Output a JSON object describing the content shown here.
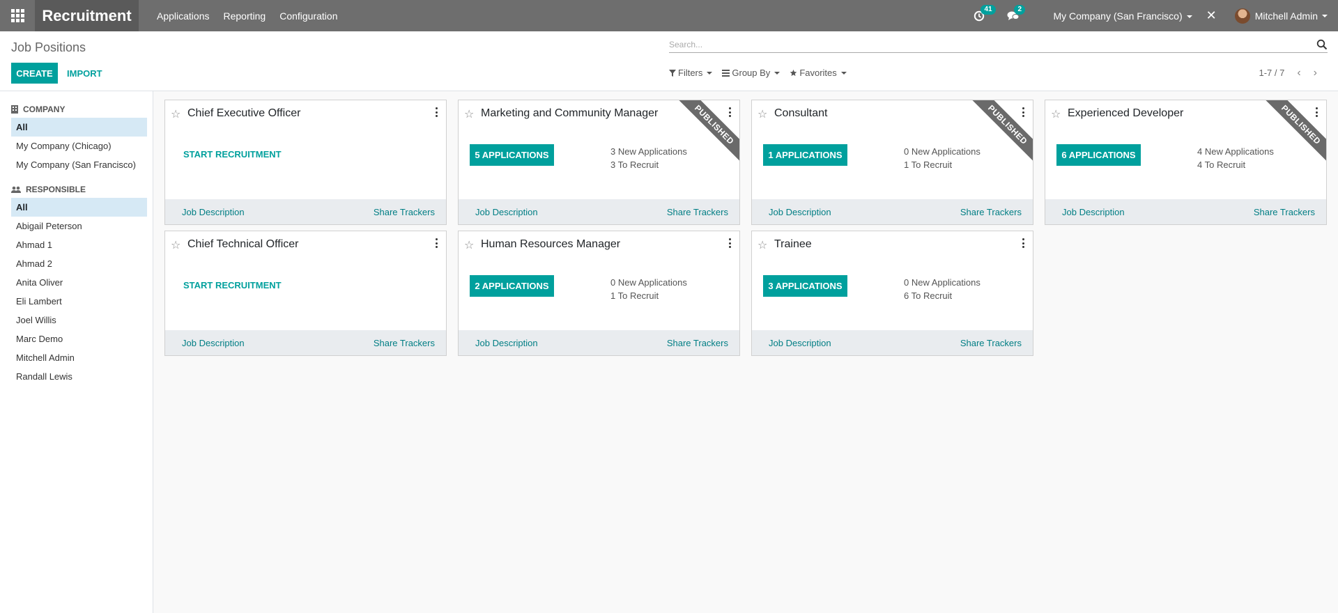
{
  "navbar": {
    "app_title": "Recruitment",
    "menu": [
      "Applications",
      "Reporting",
      "Configuration"
    ],
    "activity_count": "41",
    "message_count": "2",
    "company": "My Company (San Francisco)",
    "user": "Mitchell Admin"
  },
  "control_panel": {
    "title": "Job Positions",
    "create_label": "CREATE",
    "import_label": "IMPORT",
    "search_placeholder": "Search...",
    "filters_label": "Filters",
    "groupby_label": "Group By",
    "favorites_label": "Favorites",
    "pager": "1-7 / 7"
  },
  "sidebar": {
    "company_header": "COMPANY",
    "companies": [
      "All",
      "My Company (Chicago)",
      "My Company (San Francisco)"
    ],
    "responsible_header": "RESPONSIBLE",
    "responsibles": [
      "All",
      "Abigail Peterson",
      "Ahmad 1",
      "Ahmad 2",
      "Anita Oliver",
      "Eli Lambert",
      "Joel Willis",
      "Marc Demo",
      "Mitchell Admin",
      "Randall Lewis"
    ]
  },
  "colors": {
    "navbar": "#6e6e6e",
    "brand_bg": "#5a5a5a",
    "primary": "#00a09d",
    "ribbon": "#6a6a6a",
    "active_filter": "#d6e9f5",
    "footer_bg": "#e9ecef"
  },
  "cards": [
    {
      "title": "Chief Executive Officer",
      "published": false,
      "action": "START RECRUITMENT",
      "applications": null,
      "new_apps": null,
      "to_recruit": null,
      "job_desc": "Job Description",
      "share": "Share Trackers"
    },
    {
      "title": "Marketing and Community Manager",
      "published": true,
      "ribbon": "PUBLISHED",
      "applications": "5 APPLICATIONS",
      "new_apps": "3 New Applications",
      "to_recruit": "3 To Recruit",
      "job_desc": "Job Description",
      "share": "Share Trackers"
    },
    {
      "title": "Consultant",
      "published": true,
      "ribbon": "PUBLISHED",
      "applications": "1 APPLICATIONS",
      "new_apps": "0 New Applications",
      "to_recruit": "1 To Recruit",
      "job_desc": "Job Description",
      "share": "Share Trackers"
    },
    {
      "title": "Experienced Developer",
      "published": true,
      "ribbon": "PUBLISHED",
      "applications": "6 APPLICATIONS",
      "new_apps": "4 New Applications",
      "to_recruit": "4 To Recruit",
      "job_desc": "Job Description",
      "share": "Share Trackers"
    },
    {
      "title": "Chief Technical Officer",
      "published": false,
      "action": "START RECRUITMENT",
      "applications": null,
      "new_apps": null,
      "to_recruit": null,
      "job_desc": "Job Description",
      "share": "Share Trackers"
    },
    {
      "title": "Human Resources Manager",
      "published": false,
      "applications": "2 APPLICATIONS",
      "new_apps": "0 New Applications",
      "to_recruit": "1 To Recruit",
      "job_desc": "Job Description",
      "share": "Share Trackers"
    },
    {
      "title": "Trainee",
      "published": false,
      "applications": "3 APPLICATIONS",
      "new_apps": "0 New Applications",
      "to_recruit": "6 To Recruit",
      "job_desc": "Job Description",
      "share": "Share Trackers"
    }
  ]
}
